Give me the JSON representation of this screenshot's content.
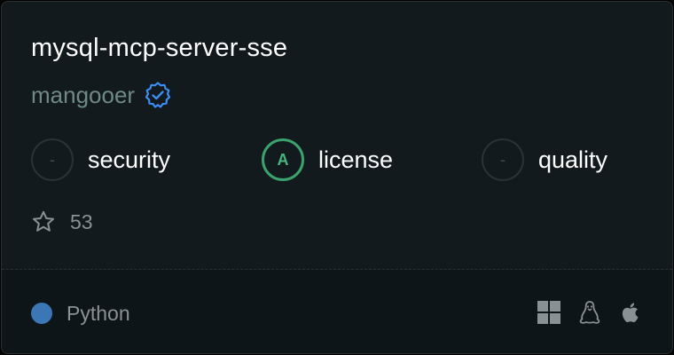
{
  "server": {
    "name": "mysql-mcp-server-sse",
    "author": "mangooer",
    "verified": true,
    "stars": "53"
  },
  "metrics": [
    {
      "label": "security",
      "grade": "-"
    },
    {
      "label": "license",
      "grade": "A"
    },
    {
      "label": "quality",
      "grade": "-"
    }
  ],
  "footer": {
    "language": "Python",
    "language_color": "#3b77b5",
    "platforms": [
      "windows-icon",
      "linux-icon",
      "apple-icon"
    ]
  },
  "colors": {
    "background": "#121a1d",
    "accent_verified": "#3a8ef6",
    "grade_good": "#3aa36d"
  }
}
